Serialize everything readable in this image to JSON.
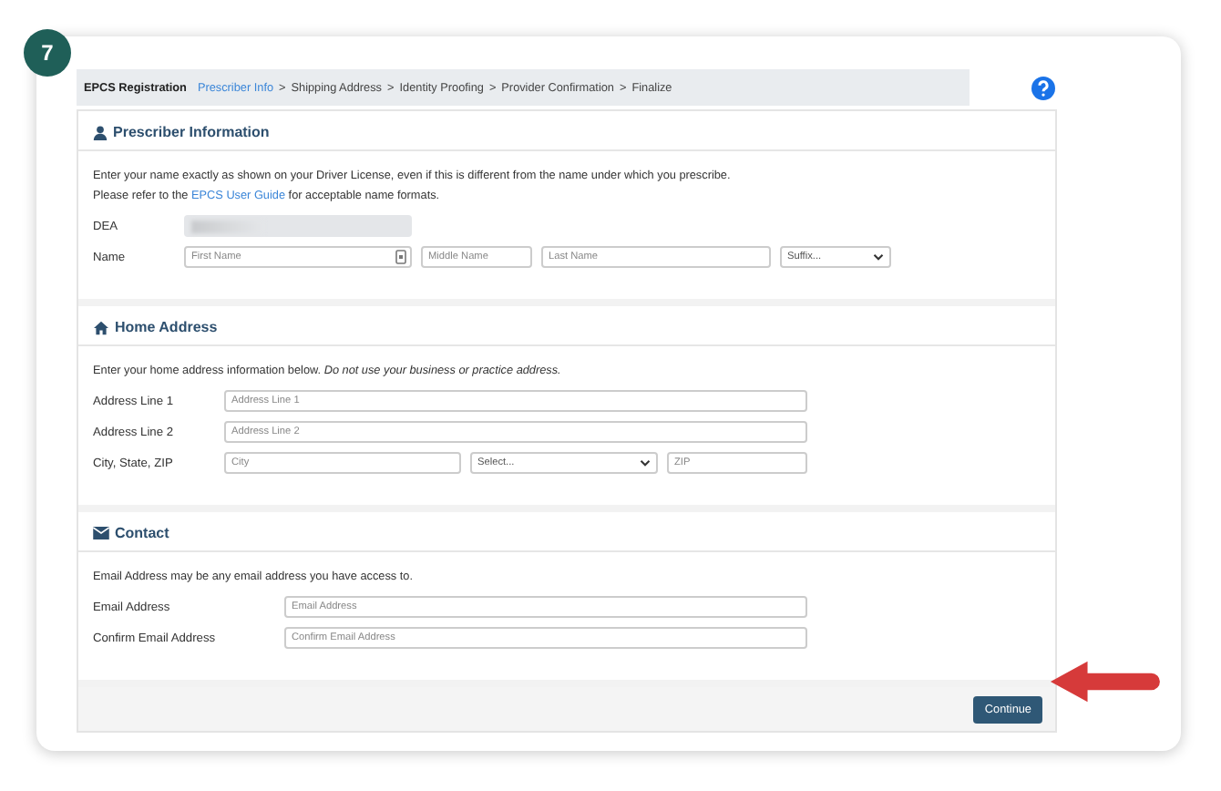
{
  "step_badge": "7",
  "breadcrumb": {
    "title": "EPCS Registration",
    "steps": [
      {
        "label": "Prescriber Info",
        "selected": true,
        "separator": ">"
      },
      {
        "label": "Shipping Address",
        "selected": false,
        "separator": ">"
      },
      {
        "label": "Identity Proofing",
        "selected": false,
        "separator": ">"
      },
      {
        "label": "Provider Confirmation",
        "selected": false,
        "separator": ">"
      },
      {
        "label": "Finalize",
        "selected": false
      }
    ]
  },
  "sections": [
    {
      "title": "Prescriber Information",
      "intro": [
        {
          "text": "Enter your name exactly as shown on your Driver License, even if this is different from the name under which you prescribe."
        },
        {
          "text": "Please refer to the",
          "link": "EPCS User Guide",
          "after": "for acceptable name formats."
        }
      ],
      "rows": [
        {
          "label": "DEA",
          "inputs": [
            {
              "kind": "masked"
            }
          ]
        },
        {
          "label": "Name",
          "inputs": [
            {
              "kind": "text",
              "placeholder": "First Name",
              "card_icon": true
            },
            {
              "kind": "text",
              "placeholder": "Middle Name"
            },
            {
              "kind": "text",
              "placeholder": "Last Name"
            },
            {
              "kind": "select",
              "value": "Suffix..."
            }
          ]
        }
      ]
    },
    {
      "title": "Home Address",
      "intro": [
        {
          "text": "Enter your home address information below. *Do not use your business or practice address.*"
        }
      ],
      "rows": [
        {
          "label": "Address Line 1",
          "inputs": [
            {
              "kind": "text",
              "placeholder": "Address Line 1"
            }
          ]
        },
        {
          "label": "Address Line 2",
          "inputs": [
            {
              "kind": "text",
              "placeholder": "Address Line 2"
            }
          ]
        },
        {
          "label": "City, State, ZIP",
          "inputs": [
            {
              "kind": "text",
              "placeholder": "City"
            },
            {
              "kind": "select",
              "value": "Select..."
            },
            {
              "kind": "text",
              "placeholder": "ZIP"
            }
          ]
        }
      ]
    },
    {
      "title": "Contact",
      "intro": [
        {
          "text": "Email Address may be any email address you have access to."
        }
      ],
      "rows": [
        {
          "label": "Email Address",
          "inputs": [
            {
              "kind": "text",
              "placeholder": "Email Address"
            }
          ]
        },
        {
          "label": "Confirm Email Address",
          "inputs": [
            {
              "kind": "text",
              "placeholder": "Confirm Email Address"
            }
          ]
        }
      ]
    }
  ],
  "continue_button": "Continue"
}
